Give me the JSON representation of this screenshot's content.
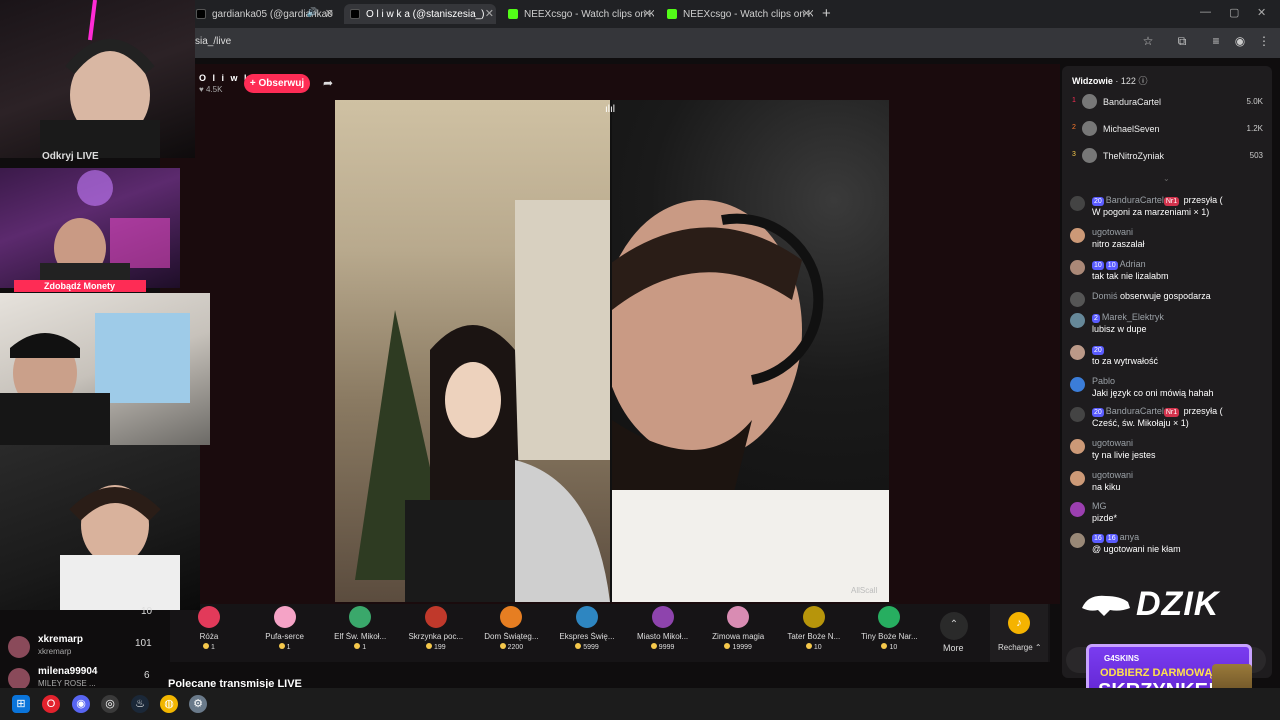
{
  "browser": {
    "tabs": [
      {
        "title": "gardianka05 (@gardianka0",
        "favicon": "tiktok-icon",
        "active": false
      },
      {
        "title": "O l i w k a (@staniszesia_)",
        "favicon": "tiktok-icon",
        "active": true
      },
      {
        "title": "NEEXcsgo - Watch clips on Kick",
        "favicon": "kick-icon",
        "active": false
      },
      {
        "title": "NEEXcsgo - Watch clips on Kick",
        "favicon": "kick-icon",
        "active": false
      }
    ],
    "url": "sia_/live"
  },
  "stream": {
    "streamer_name": "O l i w k a",
    "likes": "4.5K",
    "follow_label": "+ Obserwuj",
    "watermark": "AllScall"
  },
  "gifts": [
    {
      "name": "Róża",
      "price": "1",
      "color": "#e23a5a"
    },
    {
      "name": "Pufa-serce",
      "price": "1",
      "color": "#f5a3c6"
    },
    {
      "name": "Elf Św. Mikoł...",
      "price": "1",
      "color": "#3aa86b"
    },
    {
      "name": "Skrzynka poc...",
      "price": "199",
      "color": "#c0392b"
    },
    {
      "name": "Dom Świąteg...",
      "price": "2200",
      "color": "#e67e22"
    },
    {
      "name": "Ekspres Świę...",
      "price": "5999",
      "color": "#2e86c1"
    },
    {
      "name": "Miasto Mikoł...",
      "price": "9999",
      "color": "#8e44ad"
    },
    {
      "name": "Zimowa magia",
      "price": "19999",
      "color": "#d98cb3"
    },
    {
      "name": "Tater Boże N...",
      "price": "10",
      "color": "#b7950b"
    },
    {
      "name": "Tiny Boże Nar...",
      "price": "10",
      "color": "#27ae60"
    }
  ],
  "gift_more_label": "More",
  "recharge_label": "Recharge",
  "recommended_label": "Polecane transmisje LIVE",
  "viewers": {
    "title": "Widzowie",
    "count": "122",
    "top": [
      {
        "rank": "1",
        "name": "BanduraCartel",
        "score": "5.0K",
        "rank_color": "#fe2c55"
      },
      {
        "rank": "2",
        "name": "MichaelSeven",
        "score": "1.2K",
        "rank_color": "#fe7a2c"
      },
      {
        "rank": "3",
        "name": "TheNitroZyniak",
        "score": "503",
        "rank_color": "#f5c84b"
      }
    ]
  },
  "chat": [
    {
      "badges": [
        "20"
      ],
      "user": "BanduraCartel",
      "extra_badge": "Nr1",
      "inline": "przesyła (",
      "text": "W pogoni za marzeniami × 1)",
      "avatar": "#444"
    },
    {
      "badges": [],
      "user": "ugotowani",
      "text": "nitro zaszalał",
      "avatar": "#c97"
    },
    {
      "badges": [
        "10",
        "10"
      ],
      "user": "Adrian",
      "text": "tak tak nie lizalabm",
      "avatar": "#a87"
    },
    {
      "badges": [],
      "user": "Domiś",
      "inline": "obserwuje gospodarza",
      "text": "",
      "avatar": "#555"
    },
    {
      "badges": [
        "2"
      ],
      "user": "Marek_Elektryk",
      "text": "lubisz w dupe",
      "avatar": "#689"
    },
    {
      "badges": [
        "20"
      ],
      "user": "",
      "text": "to za wytrwałość",
      "avatar": "#b98"
    },
    {
      "badges": [],
      "user": "Pablo",
      "text": "Jaki język co oni mówią hahah",
      "avatar": "#3b7dd8"
    },
    {
      "badges": [
        "20"
      ],
      "user": "BanduraCartel",
      "extra_badge": "Nr1",
      "inline": "przesyła (",
      "text": "Cześć, św. Mikołaju × 1)",
      "avatar": "#444"
    },
    {
      "badges": [],
      "user": "ugotowani",
      "text": "ty na livie jestes",
      "avatar": "#c97"
    },
    {
      "badges": [],
      "user": "ugotowani",
      "text": "na kiku",
      "avatar": "#c97"
    },
    {
      "badges": [],
      "user": "MG",
      "text": "pizde*",
      "avatar": "#9b3fb0"
    },
    {
      "badges": [
        "16",
        "16"
      ],
      "user": "anya",
      "text": "@ ugotowani nie kłam",
      "avatar": "#987"
    }
  ],
  "overlay": {
    "odkryj": "Odkryj LIVE",
    "zdobadz": "Zdobądź Monety",
    "leaderboard": [
      {
        "name": "xkremarp",
        "sub": "xkremarp",
        "value": "101"
      },
      {
        "name": "milena99904",
        "sub": "MILEY ROSE ...",
        "value": "6"
      }
    ],
    "lb_top_value": "10",
    "dzik": "DZIK",
    "promo_brand": "G4SKINS",
    "promo_line1": "ODBIERZ DARMOWĄ",
    "promo_line2": "SKRZYNKĘ!"
  }
}
